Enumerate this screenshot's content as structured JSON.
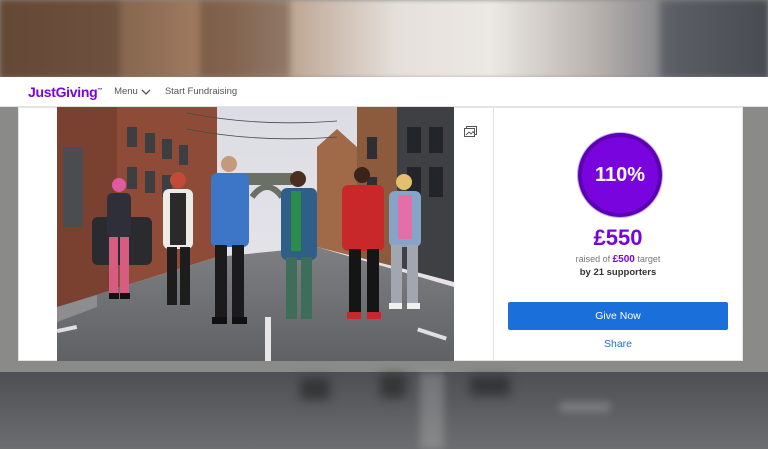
{
  "header": {
    "logo": "JustGiving",
    "logo_mark": "™",
    "menu_label": "Menu",
    "start_fundraising": "Start Fundraising"
  },
  "photo": {
    "description_icon": "gallery-icon"
  },
  "fundraising": {
    "percent": "110%",
    "raised": "£550",
    "raised_of_prefix": "raised of",
    "target_amount": "£500",
    "target_suffix": "target",
    "supporters": "by 21 supporters",
    "give_button": "Give Now",
    "share_link": "Share"
  },
  "colors": {
    "brand_purple": "#7a04dd",
    "button_blue": "#1a6fdb"
  }
}
